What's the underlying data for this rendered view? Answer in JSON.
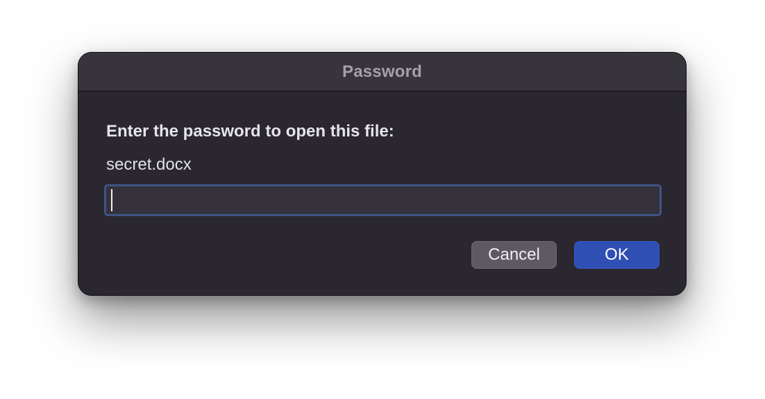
{
  "dialog": {
    "title": "Password",
    "prompt": "Enter the password to open this file:",
    "filename": "secret.docx",
    "password_field": {
      "value": "",
      "placeholder": ""
    },
    "buttons": {
      "cancel_label": "Cancel",
      "ok_label": "OK"
    }
  },
  "colors": {
    "dialog_background": "#2a2730",
    "titlebar_background": "#37343c",
    "focus_ring": "#3f5486",
    "default_button": "#2f4fb5",
    "secondary_button": "#5d5a62"
  }
}
